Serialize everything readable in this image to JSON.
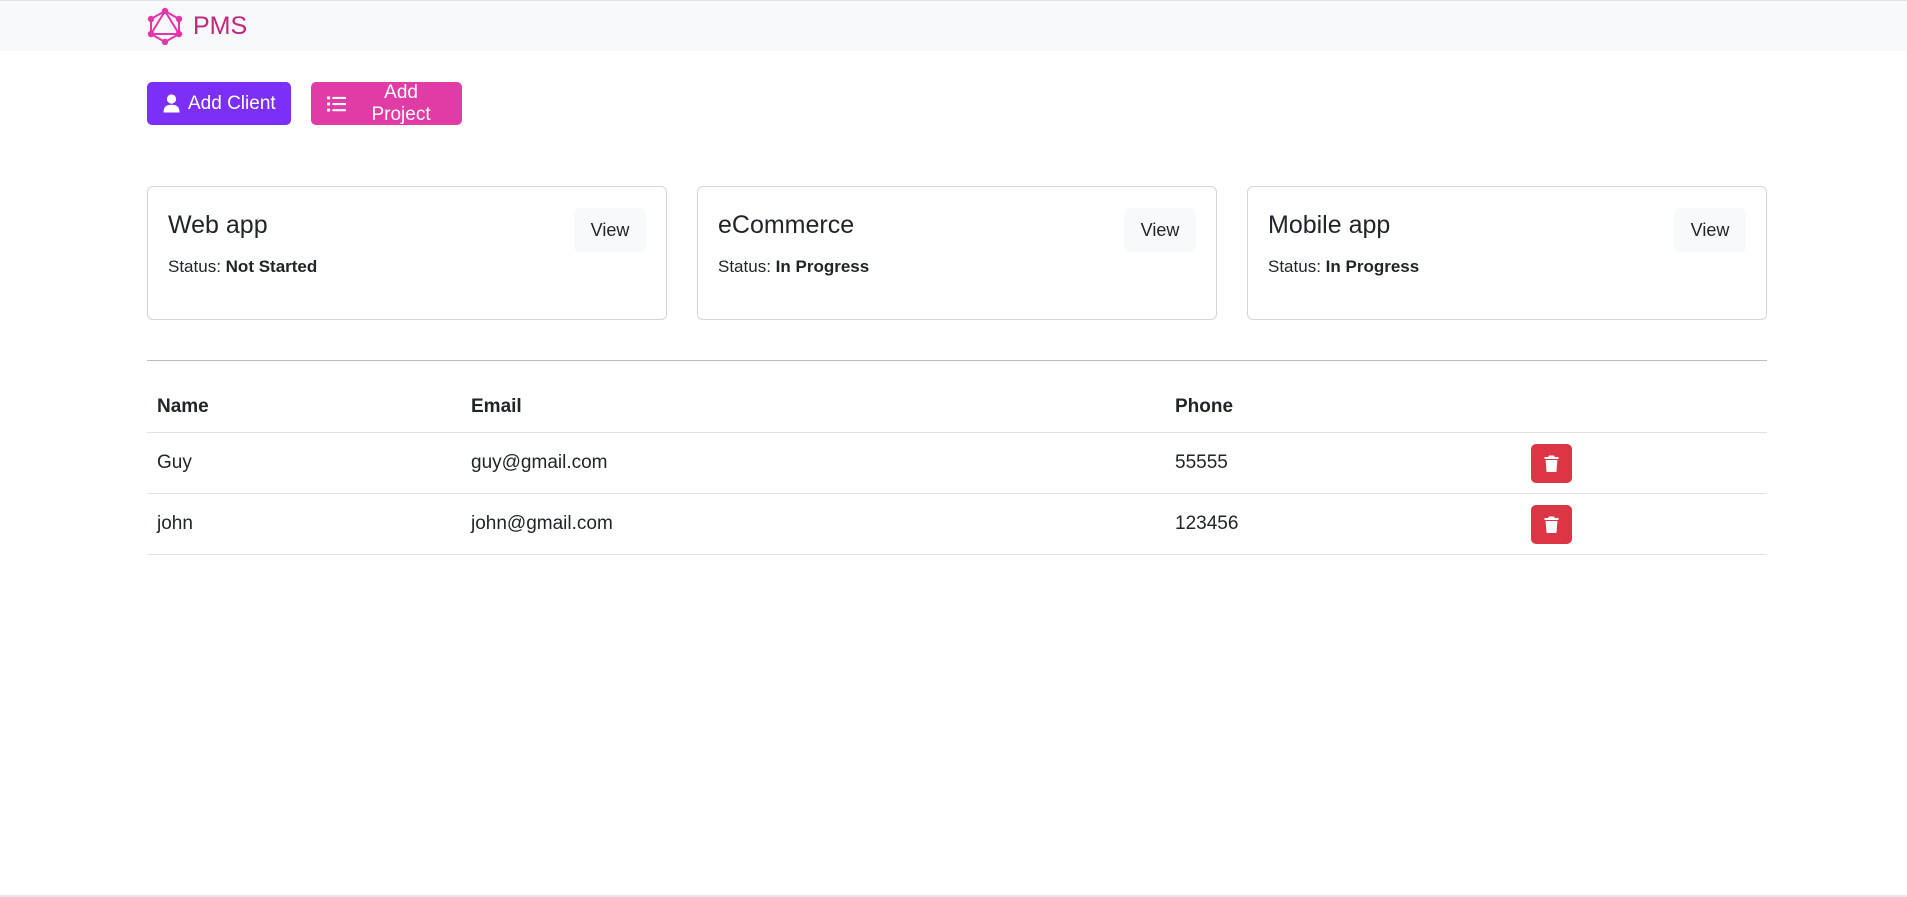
{
  "navbar": {
    "brand_text": "PMS",
    "logo_icon": "graphql-logo-icon",
    "brand_color": "#c2257e"
  },
  "actions": {
    "add_client_label": "Add Client",
    "add_client_icon": "user-icon",
    "add_client_color": "#7b2ff7",
    "add_project_label": "Add Project",
    "add_project_icon": "list-icon",
    "add_project_color": "#e13ba6"
  },
  "projects": [
    {
      "name": "Web app",
      "status_label": "Status:",
      "status": "Not Started",
      "view_label": "View"
    },
    {
      "name": "eCommerce",
      "status_label": "Status:",
      "status": "In Progress",
      "view_label": "View"
    },
    {
      "name": "Mobile app",
      "status_label": "Status:",
      "status": "In Progress",
      "view_label": "View"
    }
  ],
  "clients_table": {
    "headers": [
      "Name",
      "Email",
      "Phone",
      ""
    ],
    "rows": [
      {
        "name": "Guy",
        "email": "guy@gmail.com",
        "phone": "55555",
        "action_icon": "trash-icon"
      },
      {
        "name": "john",
        "email": "john@gmail.com",
        "phone": "123456",
        "action_icon": "trash-icon"
      }
    ],
    "delete_color": "#dc3545"
  }
}
